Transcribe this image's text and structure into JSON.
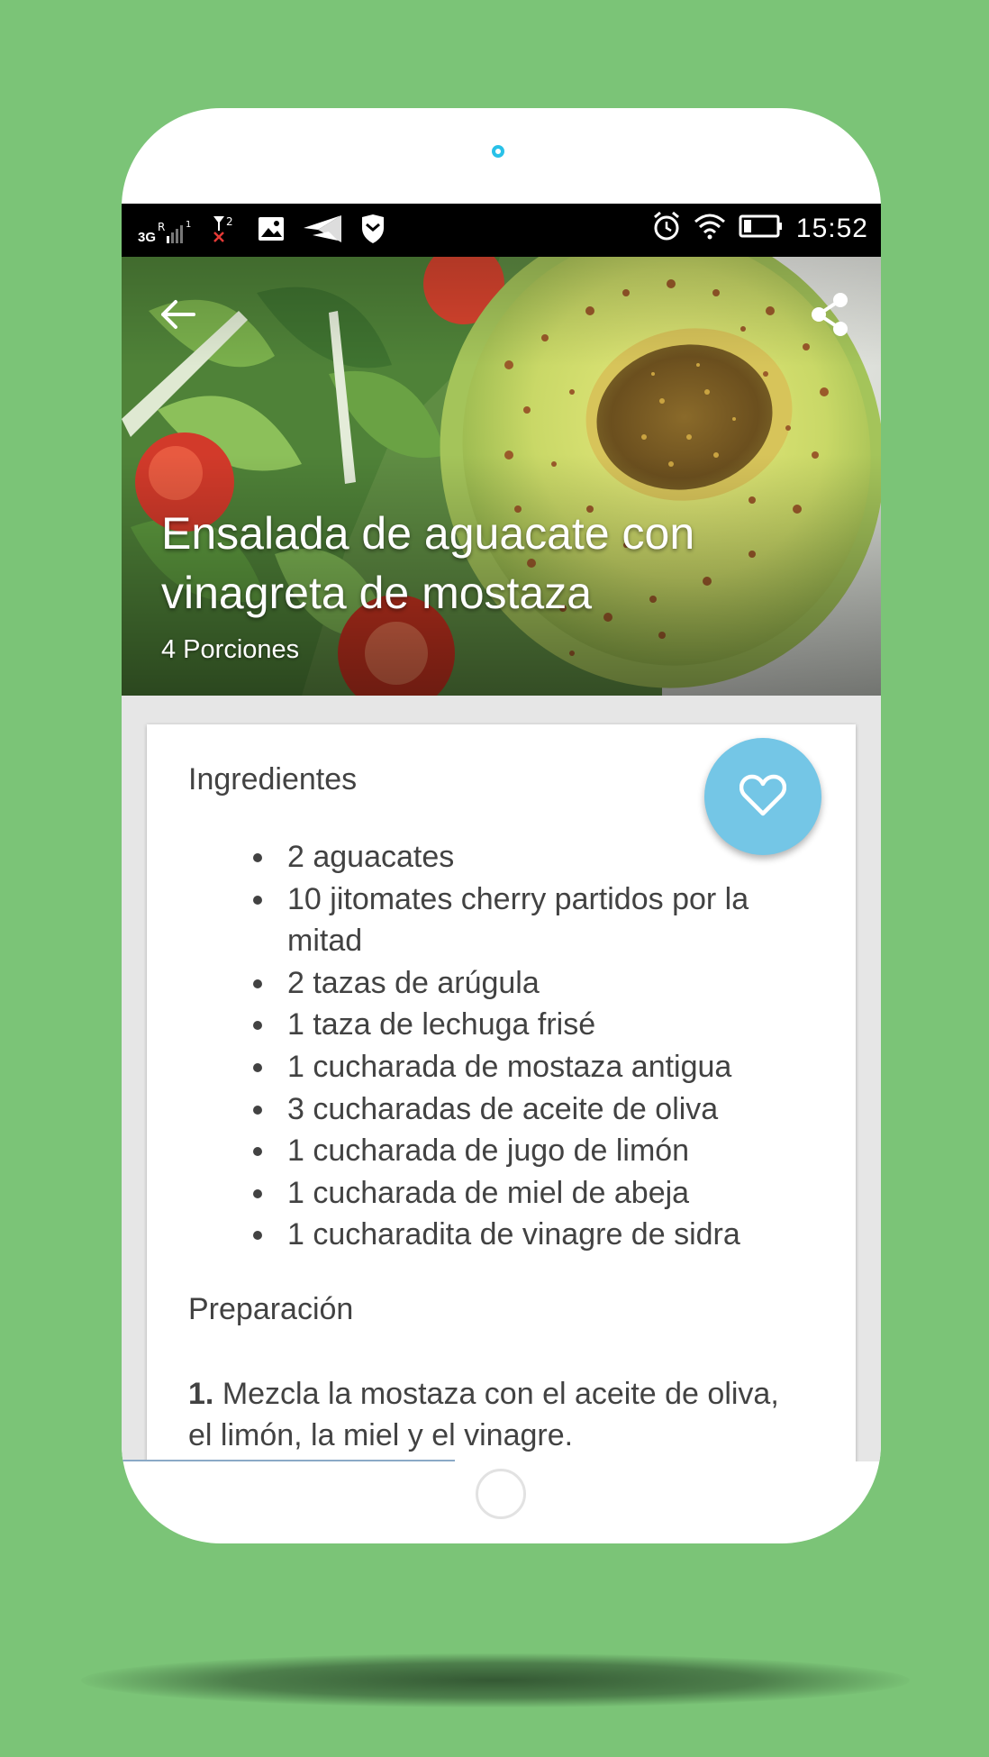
{
  "status_bar": {
    "network": "3G",
    "sim2": "2",
    "time": "15:52"
  },
  "recipe": {
    "title": "Ensalada de aguacate con vinagreta de mostaza",
    "servings": "4 Porciones",
    "ingredients_heading": "Ingredientes",
    "ingredients": [
      "2 aguacates",
      "10 jitomates cherry partidos por la mitad",
      "2 tazas de arúgula",
      "1 taza de lechuga frisé",
      "1 cucharada de mostaza antigua",
      "3 cucharadas de aceite de oliva",
      "1 cucharada de jugo de limón",
      "1 cucharada de miel de abeja",
      "1 cucharadita de vinagre de sidra"
    ],
    "preparation_heading": "Preparación",
    "steps": [
      {
        "number": "1.",
        "text": "Mezcla la mostaza con el aceite de oliva, el limón, la miel y el vinagre."
      }
    ]
  },
  "icons": {
    "back": "arrow-left-icon",
    "share": "share-icon",
    "favorite": "heart-outline-icon"
  },
  "colors": {
    "background": "#7bc477",
    "fab": "#74c6e6",
    "camera_ring": "#29c1e8"
  }
}
